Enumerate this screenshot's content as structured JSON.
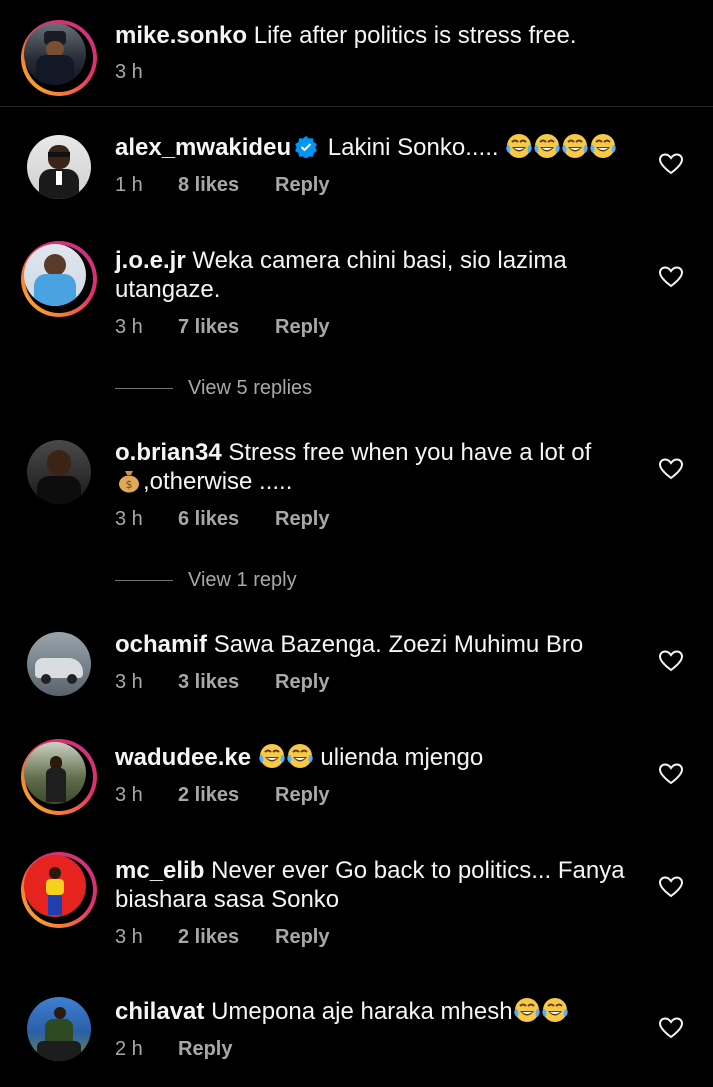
{
  "caption": {
    "username": "mike.sonko",
    "text": "Life after politics is stress free.",
    "time": "3 h"
  },
  "comments": [
    {
      "username": "alex_mwakideu",
      "verified": true,
      "text": "Lakini Sonko.....",
      "emojis": 4,
      "time": "1 h",
      "likes": "8 likes",
      "reply": "Reply"
    },
    {
      "username": "j.o.e.jr",
      "text": "Weka camera chini basi, sio lazima utangaze.",
      "time": "3 h",
      "likes": "7 likes",
      "reply": "Reply",
      "view_replies": "View 5 replies"
    },
    {
      "username": "o.brian34",
      "text": "Stress free when you have a lot of",
      "text2": ",otherwise .....",
      "time": "3 h",
      "likes": "6 likes",
      "reply": "Reply",
      "view_replies": "View 1 reply"
    },
    {
      "username": "ochamif",
      "text": "Sawa Bazenga. Zoezi Muhimu Bro",
      "time": "3 h",
      "likes": "3 likes",
      "reply": "Reply"
    },
    {
      "username": "wadudee.ke",
      "text": "ulienda mjengo",
      "time": "3 h",
      "likes": "2 likes",
      "reply": "Reply"
    },
    {
      "username": "mc_elib",
      "text": "Never ever Go back to politics... Fanya biashara sasa Sonko",
      "time": "3 h",
      "likes": "2 likes",
      "reply": "Reply"
    },
    {
      "username": "chilavat",
      "text": "Umepona aje haraka mhesh",
      "time": "2 h",
      "reply": "Reply"
    }
  ],
  "icons": {
    "like": "heart-outline-icon",
    "verified": "verified-badge-icon",
    "emoji_laugh": "tears-of-joy-emoji",
    "emoji_money": "money-bag-emoji"
  },
  "colors": {
    "background": "#000000",
    "text": "#f5f5f5",
    "secondary": "#a8a8a8",
    "verified": "#0095f6",
    "divider": "#262626"
  }
}
